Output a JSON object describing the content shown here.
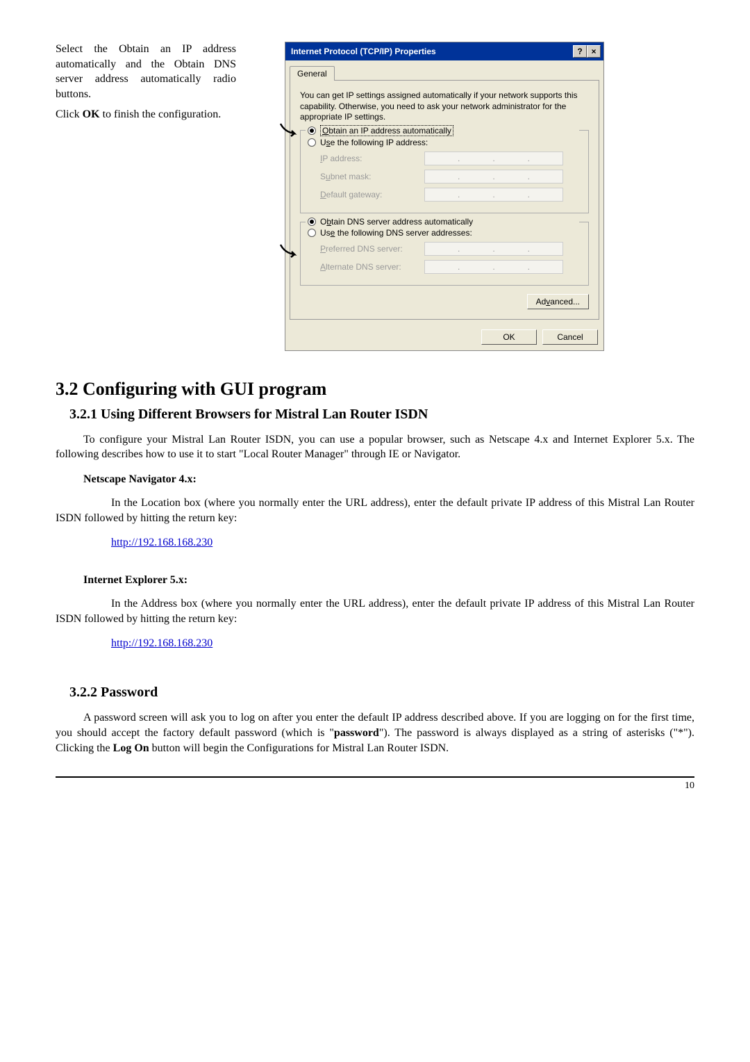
{
  "instructions": {
    "p1_a": "Select the Obtain an IP address automatically and the Obtain DNS server address automatically radio buttons.",
    "p2_a": "Click ",
    "p2_b": "OK",
    "p2_c": " to finish the configuration."
  },
  "dialog": {
    "title": "Internet Protocol (TCP/IP) Properties",
    "help_btn": "?",
    "close_btn": "×",
    "tab": "General",
    "info": "You can get IP settings assigned automatically if your network supports this capability. Otherwise, you need to ask your network administrator for the appropriate IP settings.",
    "r_ip_auto_pre": "O",
    "r_ip_auto_rest": "btain an IP address automatically",
    "r_ip_use_pre": "U",
    "r_ip_use_mid": "s",
    "r_ip_use_rest": "e the following IP address:",
    "lbl_ip_pre": "I",
    "lbl_ip_rest": "P address:",
    "lbl_sub_pre": "S",
    "lbl_sub_mid": "u",
    "lbl_sub_rest": "bnet mask:",
    "lbl_gw_pre": "D",
    "lbl_gw_rest": "efault gateway:",
    "r_dns_auto_pre": "O",
    "r_dns_auto_mid": "b",
    "r_dns_auto_rest": "tain DNS server address automatically",
    "r_dns_use_pre": "Us",
    "r_dns_use_mid": "e",
    "r_dns_use_rest": " the following DNS server addresses:",
    "lbl_pdns_pre": "P",
    "lbl_pdns_rest": "referred DNS server:",
    "lbl_adns_pre": "A",
    "lbl_adns_rest": "lternate DNS server:",
    "adv_pre": "Ad",
    "adv_mid": "v",
    "adv_rest": "anced...",
    "ok": "OK",
    "cancel": "Cancel"
  },
  "doc": {
    "h2": "3.2 Configuring with GUI program",
    "h3_1": "3.2.1 Using Different Browsers for Mistral Lan Router ISDN",
    "p1": "To configure your Mistral Lan Router ISDN, you can use a popular browser, such as Netscape 4.x and Internet Explorer 5.x.  The following describes how to use it to start \"Local Router Manager\" through IE or Navigator.",
    "sub1": "Netscape Navigator 4.x:",
    "p2": "In the Location box (where you normally enter the URL address), enter the default private IP address of this Mistral Lan Router ISDN followed by hitting the return key:",
    "link": "http://192.168.168.230",
    "sub2": "Internet Explorer 5.x:",
    "p3": "In the Address box (where you normally enter the URL address), enter the default private IP address of this Mistral Lan Router ISDN followed by hitting the return key:",
    "h3_2": "3.2.2 Password",
    "p4_a": "A password screen will ask you to log on after you enter the default IP address described above. If you are logging on for the first time, you should accept the factory default password (which is \"",
    "p4_b": "password",
    "p4_c": "\"). The password is always displayed as a string of asterisks (\"*\"). Clicking the ",
    "p4_d": "Log On",
    "p4_e": " button will begin the Configurations for Mistral Lan Router ISDN.",
    "page": "10"
  }
}
